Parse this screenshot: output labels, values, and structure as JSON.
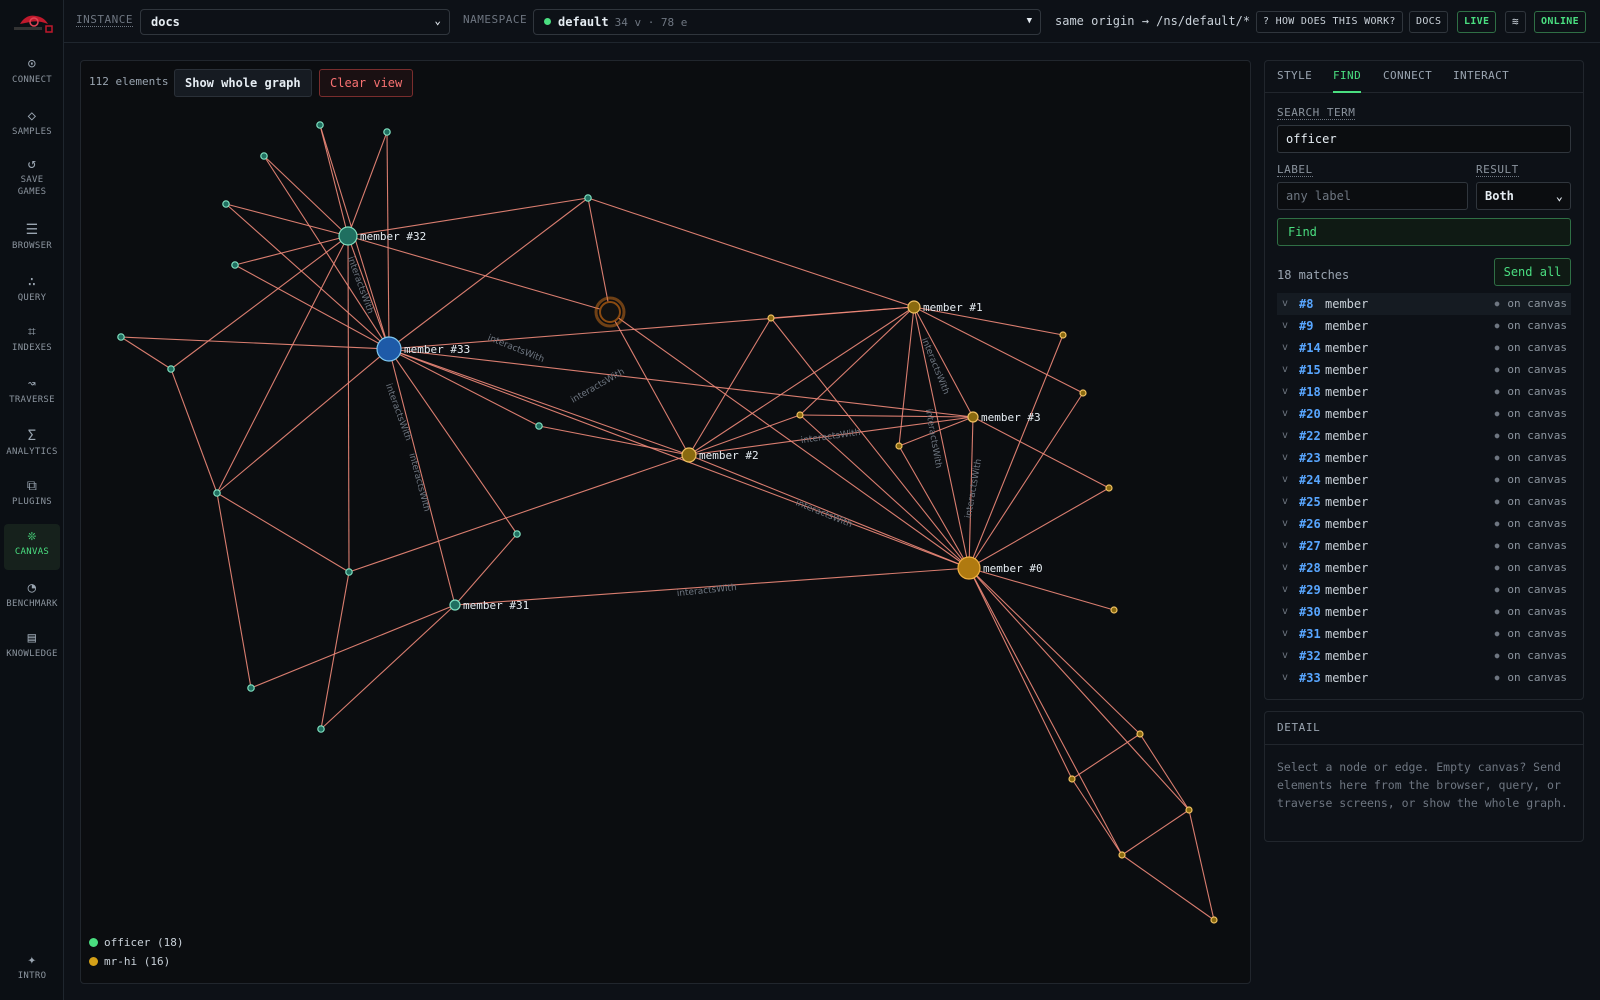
{
  "nav": [
    {
      "label": "CONNECT",
      "icon": "plug-icon",
      "glyph": "⊙"
    },
    {
      "label": "SAMPLES",
      "icon": "diamond-icon",
      "glyph": "◇"
    },
    {
      "label": "SAVE GAMES",
      "icon": "refresh-icon",
      "glyph": "↺"
    },
    {
      "label": "BROWSER",
      "icon": "list-icon",
      "glyph": "☰"
    },
    {
      "label": "QUERY",
      "icon": "query-icon",
      "glyph": "∴"
    },
    {
      "label": "INDEXES",
      "icon": "index-icon",
      "glyph": "⌗"
    },
    {
      "label": "TRAVERSE",
      "icon": "traverse-icon",
      "glyph": "↝"
    },
    {
      "label": "ANALYTICS",
      "icon": "sigma-icon",
      "glyph": "Σ"
    },
    {
      "label": "PLUGINS",
      "icon": "plugins-icon",
      "glyph": "⧉"
    },
    {
      "label": "CANVAS",
      "icon": "canvas-icon",
      "glyph": "❊"
    },
    {
      "label": "BENCHMARK",
      "icon": "gauge-icon",
      "glyph": "◔"
    },
    {
      "label": "KNOWLEDGE",
      "icon": "book-icon",
      "glyph": "▤"
    },
    {
      "label": "INTRO",
      "icon": "sparkle-icon",
      "glyph": "✦"
    }
  ],
  "topbar": {
    "instance_label": "INSTANCE",
    "instance_value": "docs",
    "namespace_label": "NAMESPACE",
    "namespace_value": "default",
    "namespace_meta": "34 v · 78 e",
    "origin": "same origin → /ns/default/*",
    "help": "? HOW DOES THIS WORK?",
    "docs": "DOCS",
    "live": "LIVE",
    "online": "ONLINE"
  },
  "canvas": {
    "count": "112 elements",
    "show_whole": "Show whole graph",
    "clear": "Clear view",
    "legend": [
      {
        "label": "officer (18)",
        "color": "#4ade80"
      },
      {
        "label": "mr-hi (16)",
        "color": "#d4a017"
      }
    ]
  },
  "panel": {
    "tabs": [
      "STYLE",
      "FIND",
      "CONNECT",
      "INTERACT"
    ],
    "active_tab": "FIND",
    "search_label": "SEARCH TERM",
    "search_value": "officer",
    "label_label": "LABEL",
    "label_placeholder": "any label",
    "result_label": "RESULT",
    "result_value": "Both",
    "find_button": "Find",
    "matches": "18 matches",
    "send_all": "Send all",
    "results": [
      {
        "id": "#8",
        "label": "member",
        "status": "on canvas"
      },
      {
        "id": "#9",
        "label": "member",
        "status": "on canvas"
      },
      {
        "id": "#14",
        "label": "member",
        "status": "on canvas"
      },
      {
        "id": "#15",
        "label": "member",
        "status": "on canvas"
      },
      {
        "id": "#18",
        "label": "member",
        "status": "on canvas"
      },
      {
        "id": "#20",
        "label": "member",
        "status": "on canvas"
      },
      {
        "id": "#22",
        "label": "member",
        "status": "on canvas"
      },
      {
        "id": "#23",
        "label": "member",
        "status": "on canvas"
      },
      {
        "id": "#24",
        "label": "member",
        "status": "on canvas"
      },
      {
        "id": "#25",
        "label": "member",
        "status": "on canvas"
      },
      {
        "id": "#26",
        "label": "member",
        "status": "on canvas"
      },
      {
        "id": "#27",
        "label": "member",
        "status": "on canvas"
      },
      {
        "id": "#28",
        "label": "member",
        "status": "on canvas"
      },
      {
        "id": "#29",
        "label": "member",
        "status": "on canvas"
      },
      {
        "id": "#30",
        "label": "member",
        "status": "on canvas"
      },
      {
        "id": "#31",
        "label": "member",
        "status": "on canvas"
      },
      {
        "id": "#32",
        "label": "member",
        "status": "on canvas"
      },
      {
        "id": "#33",
        "label": "member",
        "status": "on canvas"
      }
    ]
  },
  "detail": {
    "title": "DETAIL",
    "text": "Select a node or edge. Empty canvas? Send elements here from the browser, query, or traverse screens, or show the whole graph."
  },
  "graph": {
    "node_labels": [
      "member #32",
      "member #33",
      "member #1",
      "member #2",
      "member #3",
      "member #0",
      "member #31"
    ],
    "edge_label": "interactsWith"
  }
}
